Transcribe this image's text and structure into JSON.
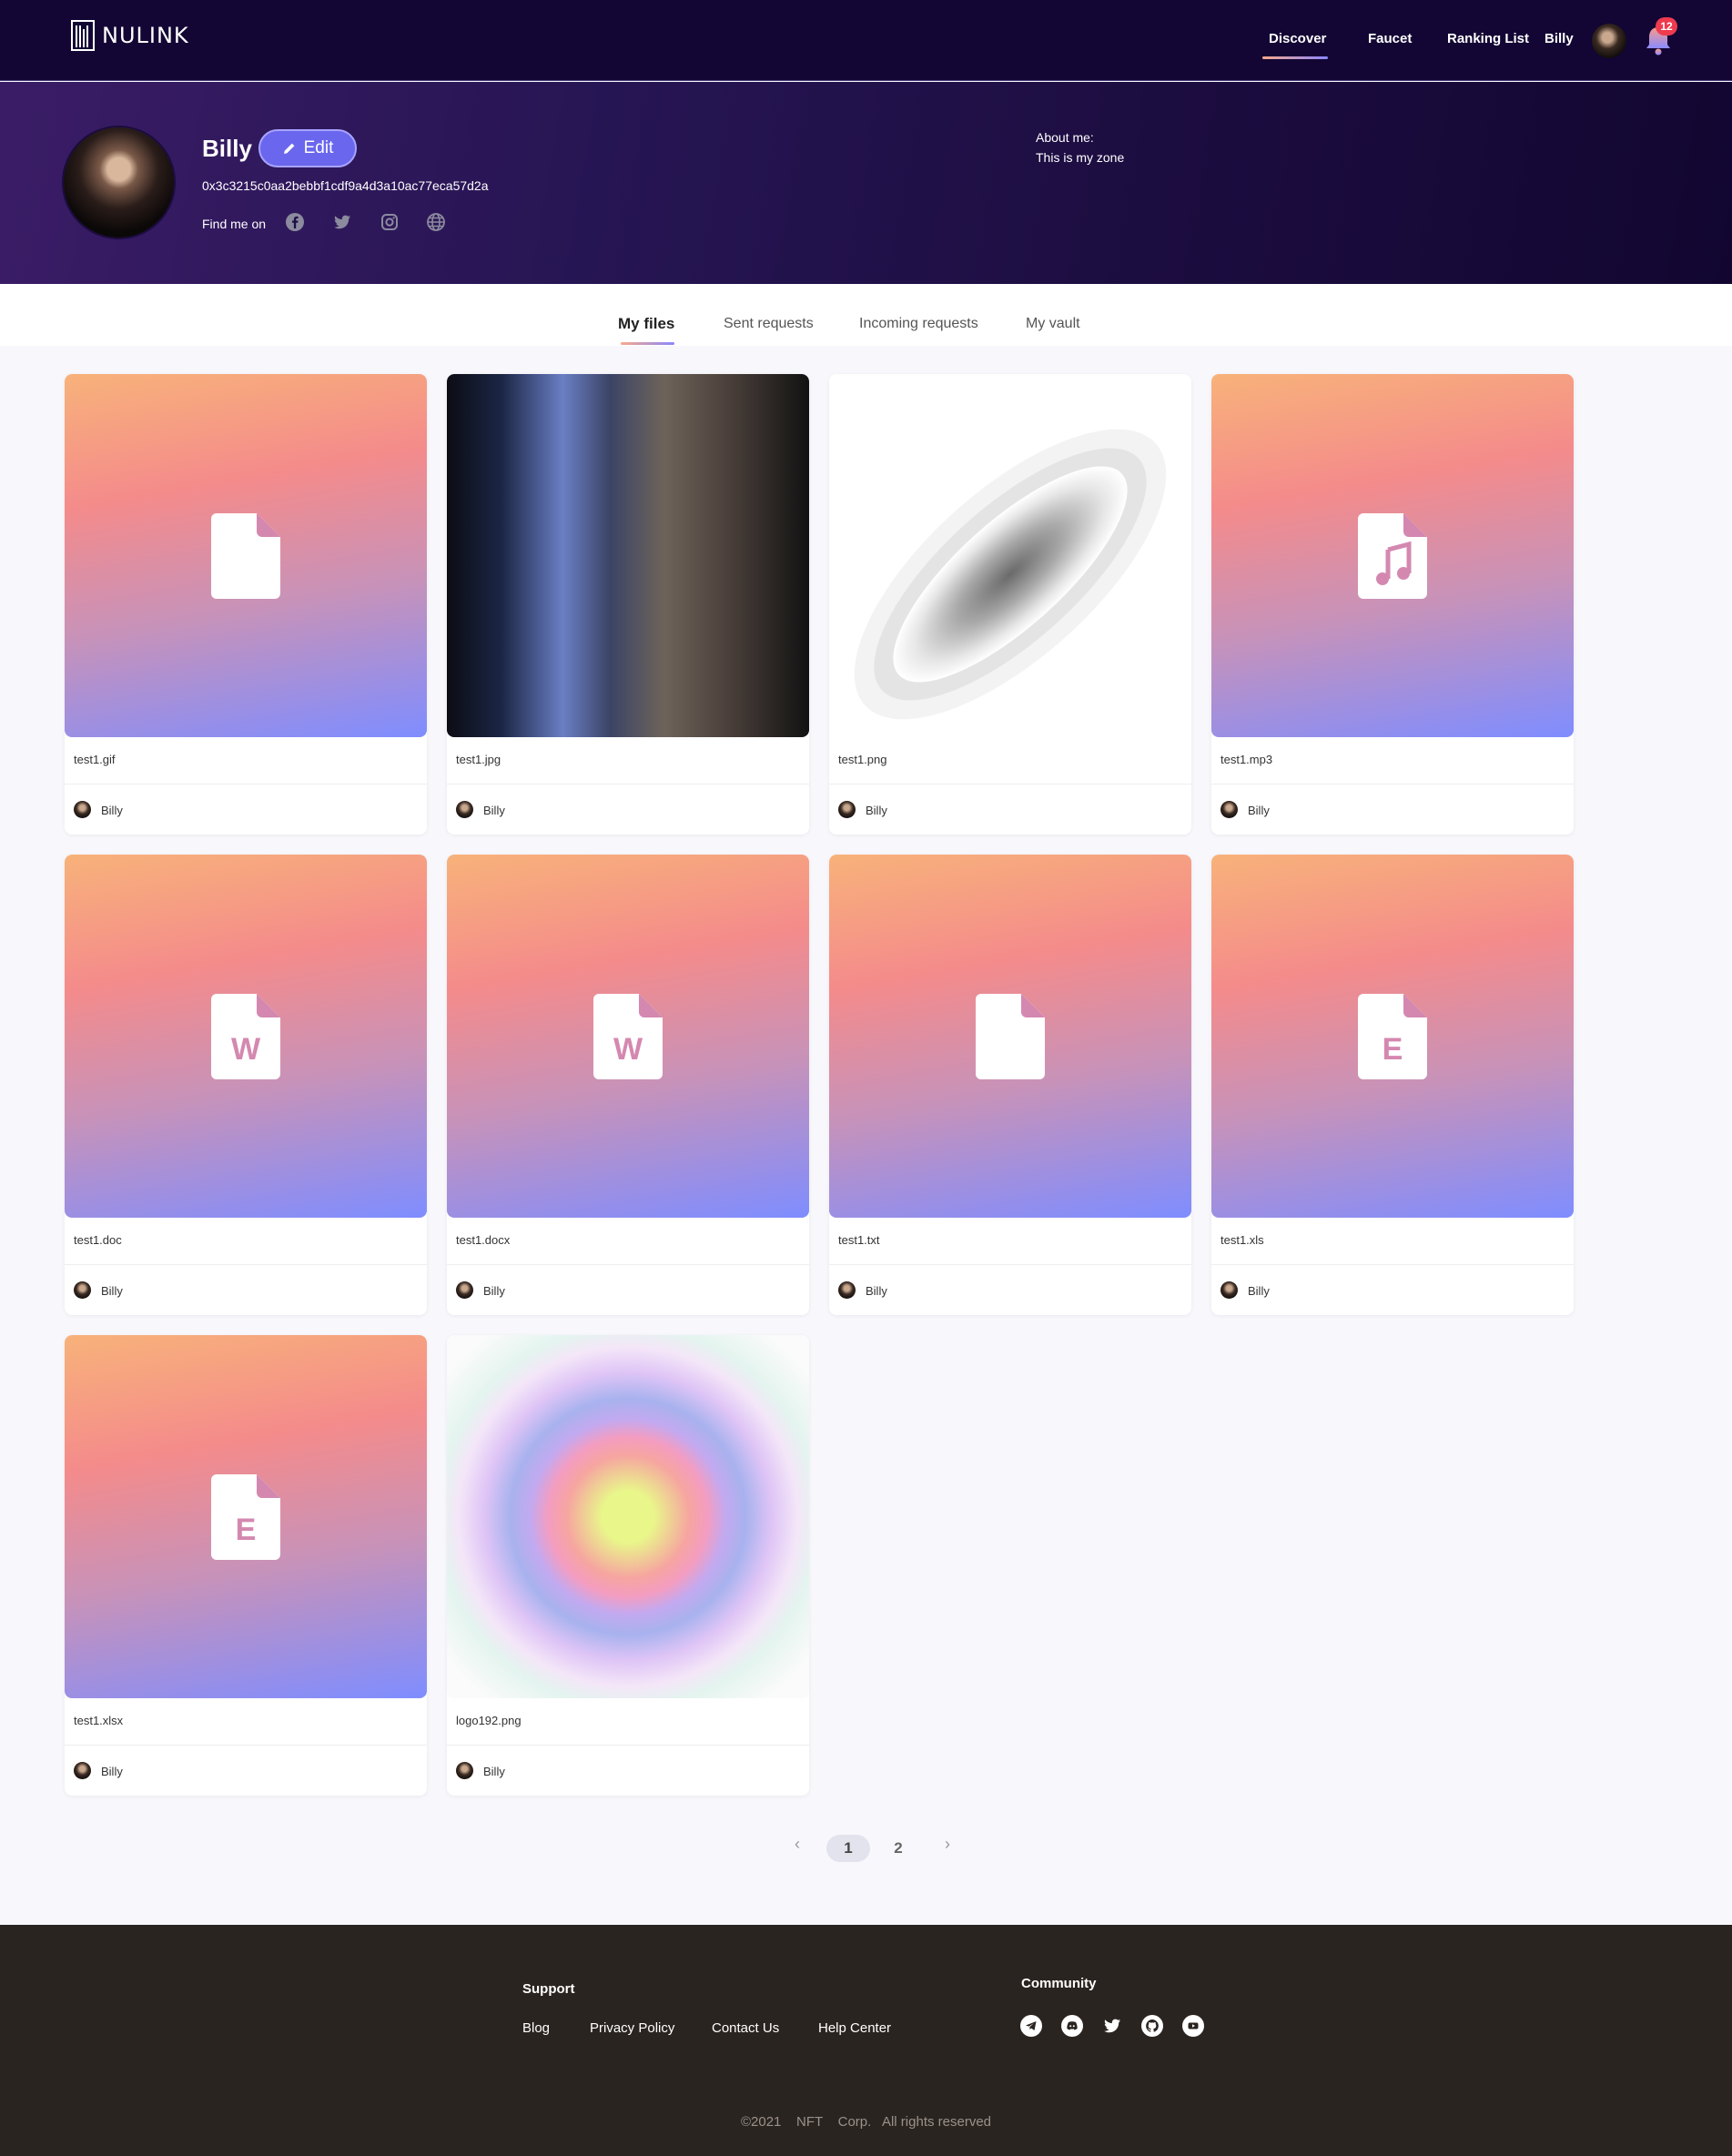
{
  "header": {
    "brand": "NULINK",
    "nav": [
      "Discover",
      "Faucet",
      "Ranking List",
      "Billy"
    ],
    "notification_count": "12"
  },
  "profile": {
    "name": "Billy",
    "edit_label": "Edit",
    "wallet_address": "0x3c3215c0aa2bebbf1cdf9a4d3a10ac77eca57d2a",
    "find_me_label": "Find me on",
    "social_icons": [
      "facebook-icon",
      "twitter-icon",
      "instagram-icon",
      "globe-icon"
    ],
    "about_label": "About me:",
    "about_text": "This is my zone"
  },
  "tabs": [
    "My files",
    "Sent requests",
    "Incoming requests",
    "My vault"
  ],
  "files": [
    {
      "name": "test1.gif",
      "owner": "Billy",
      "thumb": "file-icon"
    },
    {
      "name": "test1.jpg",
      "owner": "Billy",
      "thumb": "image"
    },
    {
      "name": "test1.png",
      "owner": "Billy",
      "thumb": "image"
    },
    {
      "name": "test1.mp3",
      "owner": "Billy",
      "thumb": "music-file-icon"
    },
    {
      "name": "test1.doc",
      "owner": "Billy",
      "thumb": "word-file-icon",
      "letter": "W"
    },
    {
      "name": "test1.docx",
      "owner": "Billy",
      "thumb": "word-file-icon",
      "letter": "W"
    },
    {
      "name": "test1.txt",
      "owner": "Billy",
      "thumb": "file-icon"
    },
    {
      "name": "test1.xls",
      "owner": "Billy",
      "thumb": "excel-file-icon",
      "letter": "E"
    },
    {
      "name": "test1.xlsx",
      "owner": "Billy",
      "thumb": "excel-file-icon",
      "letter": "E"
    },
    {
      "name": "logo192.png",
      "owner": "Billy",
      "thumb": "image"
    }
  ],
  "pagination": {
    "pages": [
      "1",
      "2"
    ],
    "current": "1",
    "prev": "‹",
    "next": "›"
  },
  "footer": {
    "support_title": "Support",
    "support_links": [
      "Blog",
      "Privacy Policy",
      "Contact Us",
      "Help Center"
    ],
    "community_title": "Community",
    "community_icons": [
      "telegram-icon",
      "discord-icon",
      "twitter-icon",
      "github-icon",
      "youtube-icon"
    ],
    "copyright": "©2021    NFT    Corp.   All rights reserved"
  },
  "colors": {
    "header_bg": "#130634",
    "accent": "#6a66ee",
    "footer_bg": "#2a2420",
    "badge": "#ef3b4e",
    "icon_pink": "#d488b0"
  }
}
